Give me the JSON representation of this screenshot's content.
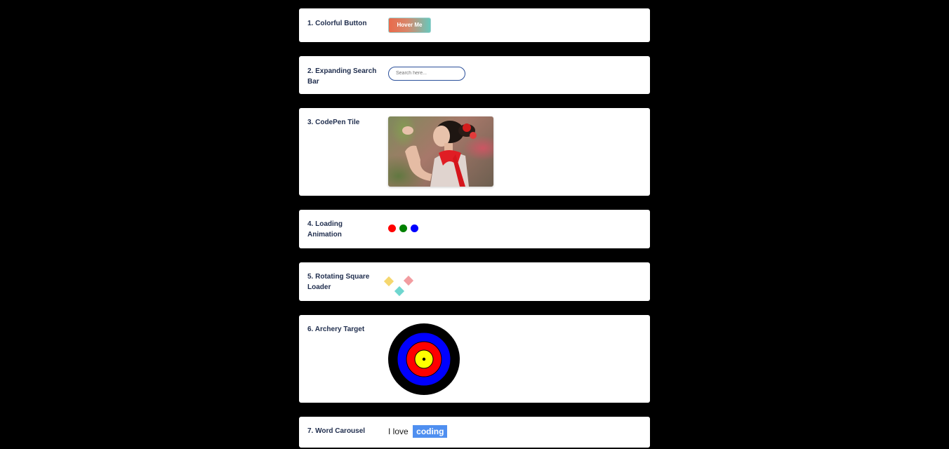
{
  "cards": [
    {
      "label": "1. Colorful Button"
    },
    {
      "label": "2. Expanding Search Bar"
    },
    {
      "label": "3. CodePen Tile"
    },
    {
      "label": "4. Loading Animation"
    },
    {
      "label": "5. Rotating Square Loader"
    },
    {
      "label": "6. Archery Target"
    },
    {
      "label": "7. Word Carousel"
    }
  ],
  "button": {
    "label": "Hover Me"
  },
  "search": {
    "placeholder": "Search here..."
  },
  "tile": {
    "alt": "Smiling woman in a red dress among flowers"
  },
  "loader": {
    "dot_colors": [
      "#ff0000",
      "#008000",
      "#0000ff"
    ]
  },
  "square_loader": {
    "square_colors": [
      "#f5d76e",
      "#f29ca0",
      "#6fd6cf"
    ]
  },
  "target": {
    "ring_colors": [
      "#000000",
      "#0000ff",
      "#ff0000",
      "#ffff00"
    ]
  },
  "carousel": {
    "prefix": "I love",
    "word": "coding"
  }
}
